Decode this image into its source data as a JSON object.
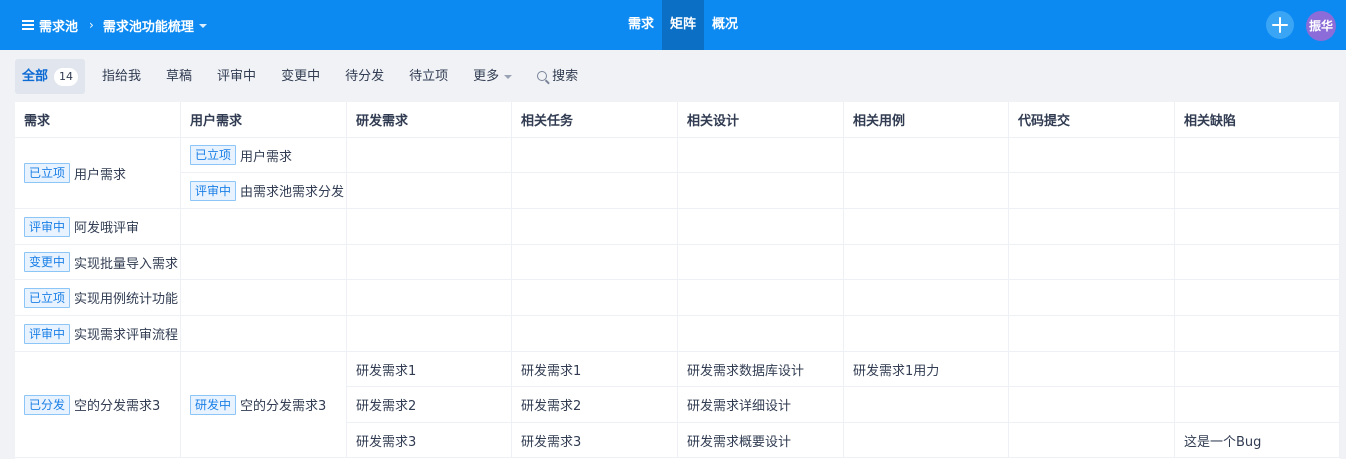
{
  "header": {
    "breadcrumb_root": "需求池",
    "breadcrumb_sep": "›",
    "breadcrumb_current": "需求池功能梳理",
    "nav": [
      {
        "label": "需求",
        "active": false
      },
      {
        "label": "矩阵",
        "active": true
      },
      {
        "label": "概况",
        "active": false
      }
    ],
    "user": "振华",
    "colors": {
      "bar": "#0c8af1",
      "active_tab": "#0a6fc5",
      "avatar": "#8b6cd8"
    }
  },
  "filters": {
    "all_label": "全部",
    "all_count": "14",
    "items": [
      "指给我",
      "草稿",
      "评审中",
      "变更中",
      "待分发",
      "待立项"
    ],
    "more_label": "更多",
    "search_label": "搜索"
  },
  "table": {
    "headers": [
      "需求",
      "用户需求",
      "研发需求",
      "相关任务",
      "相关设计",
      "相关用例",
      "代码提交",
      "相关缺陷"
    ],
    "rows": [
      {
        "req_badge": "已立项",
        "req_title": "用户需求",
        "user_reqs": [
          {
            "badge": "已立项",
            "title": "用户需求"
          },
          {
            "badge": "评审中",
            "title": "由需求池需求分发"
          }
        ]
      },
      {
        "req_badge": "评审中",
        "req_title": "阿发哦评审"
      },
      {
        "req_badge": "变更中",
        "req_title": "实现批量导入需求"
      },
      {
        "req_badge": "已立项",
        "req_title": "实现用例统计功能"
      },
      {
        "req_badge": "评审中",
        "req_title": "实现需求评审流程"
      },
      {
        "req_badge": "已分发",
        "req_title": "空的分发需求3",
        "user_badge": "研发中",
        "user_title": "空的分发需求3",
        "dev_rows": [
          {
            "dev": "研发需求1",
            "task": "研发需求1",
            "design": "研发需求数据库设计",
            "case": "研发需求1用力",
            "commit": "",
            "bug": ""
          },
          {
            "dev": "研发需求2",
            "task": "研发需求2",
            "design": "研发需求详细设计",
            "case": "",
            "commit": "",
            "bug": ""
          },
          {
            "dev": "研发需求3",
            "task": "研发需求3",
            "design": "研发需求概要设计",
            "case": "",
            "commit": "",
            "bug": "这是一个Bug"
          }
        ]
      }
    ]
  }
}
